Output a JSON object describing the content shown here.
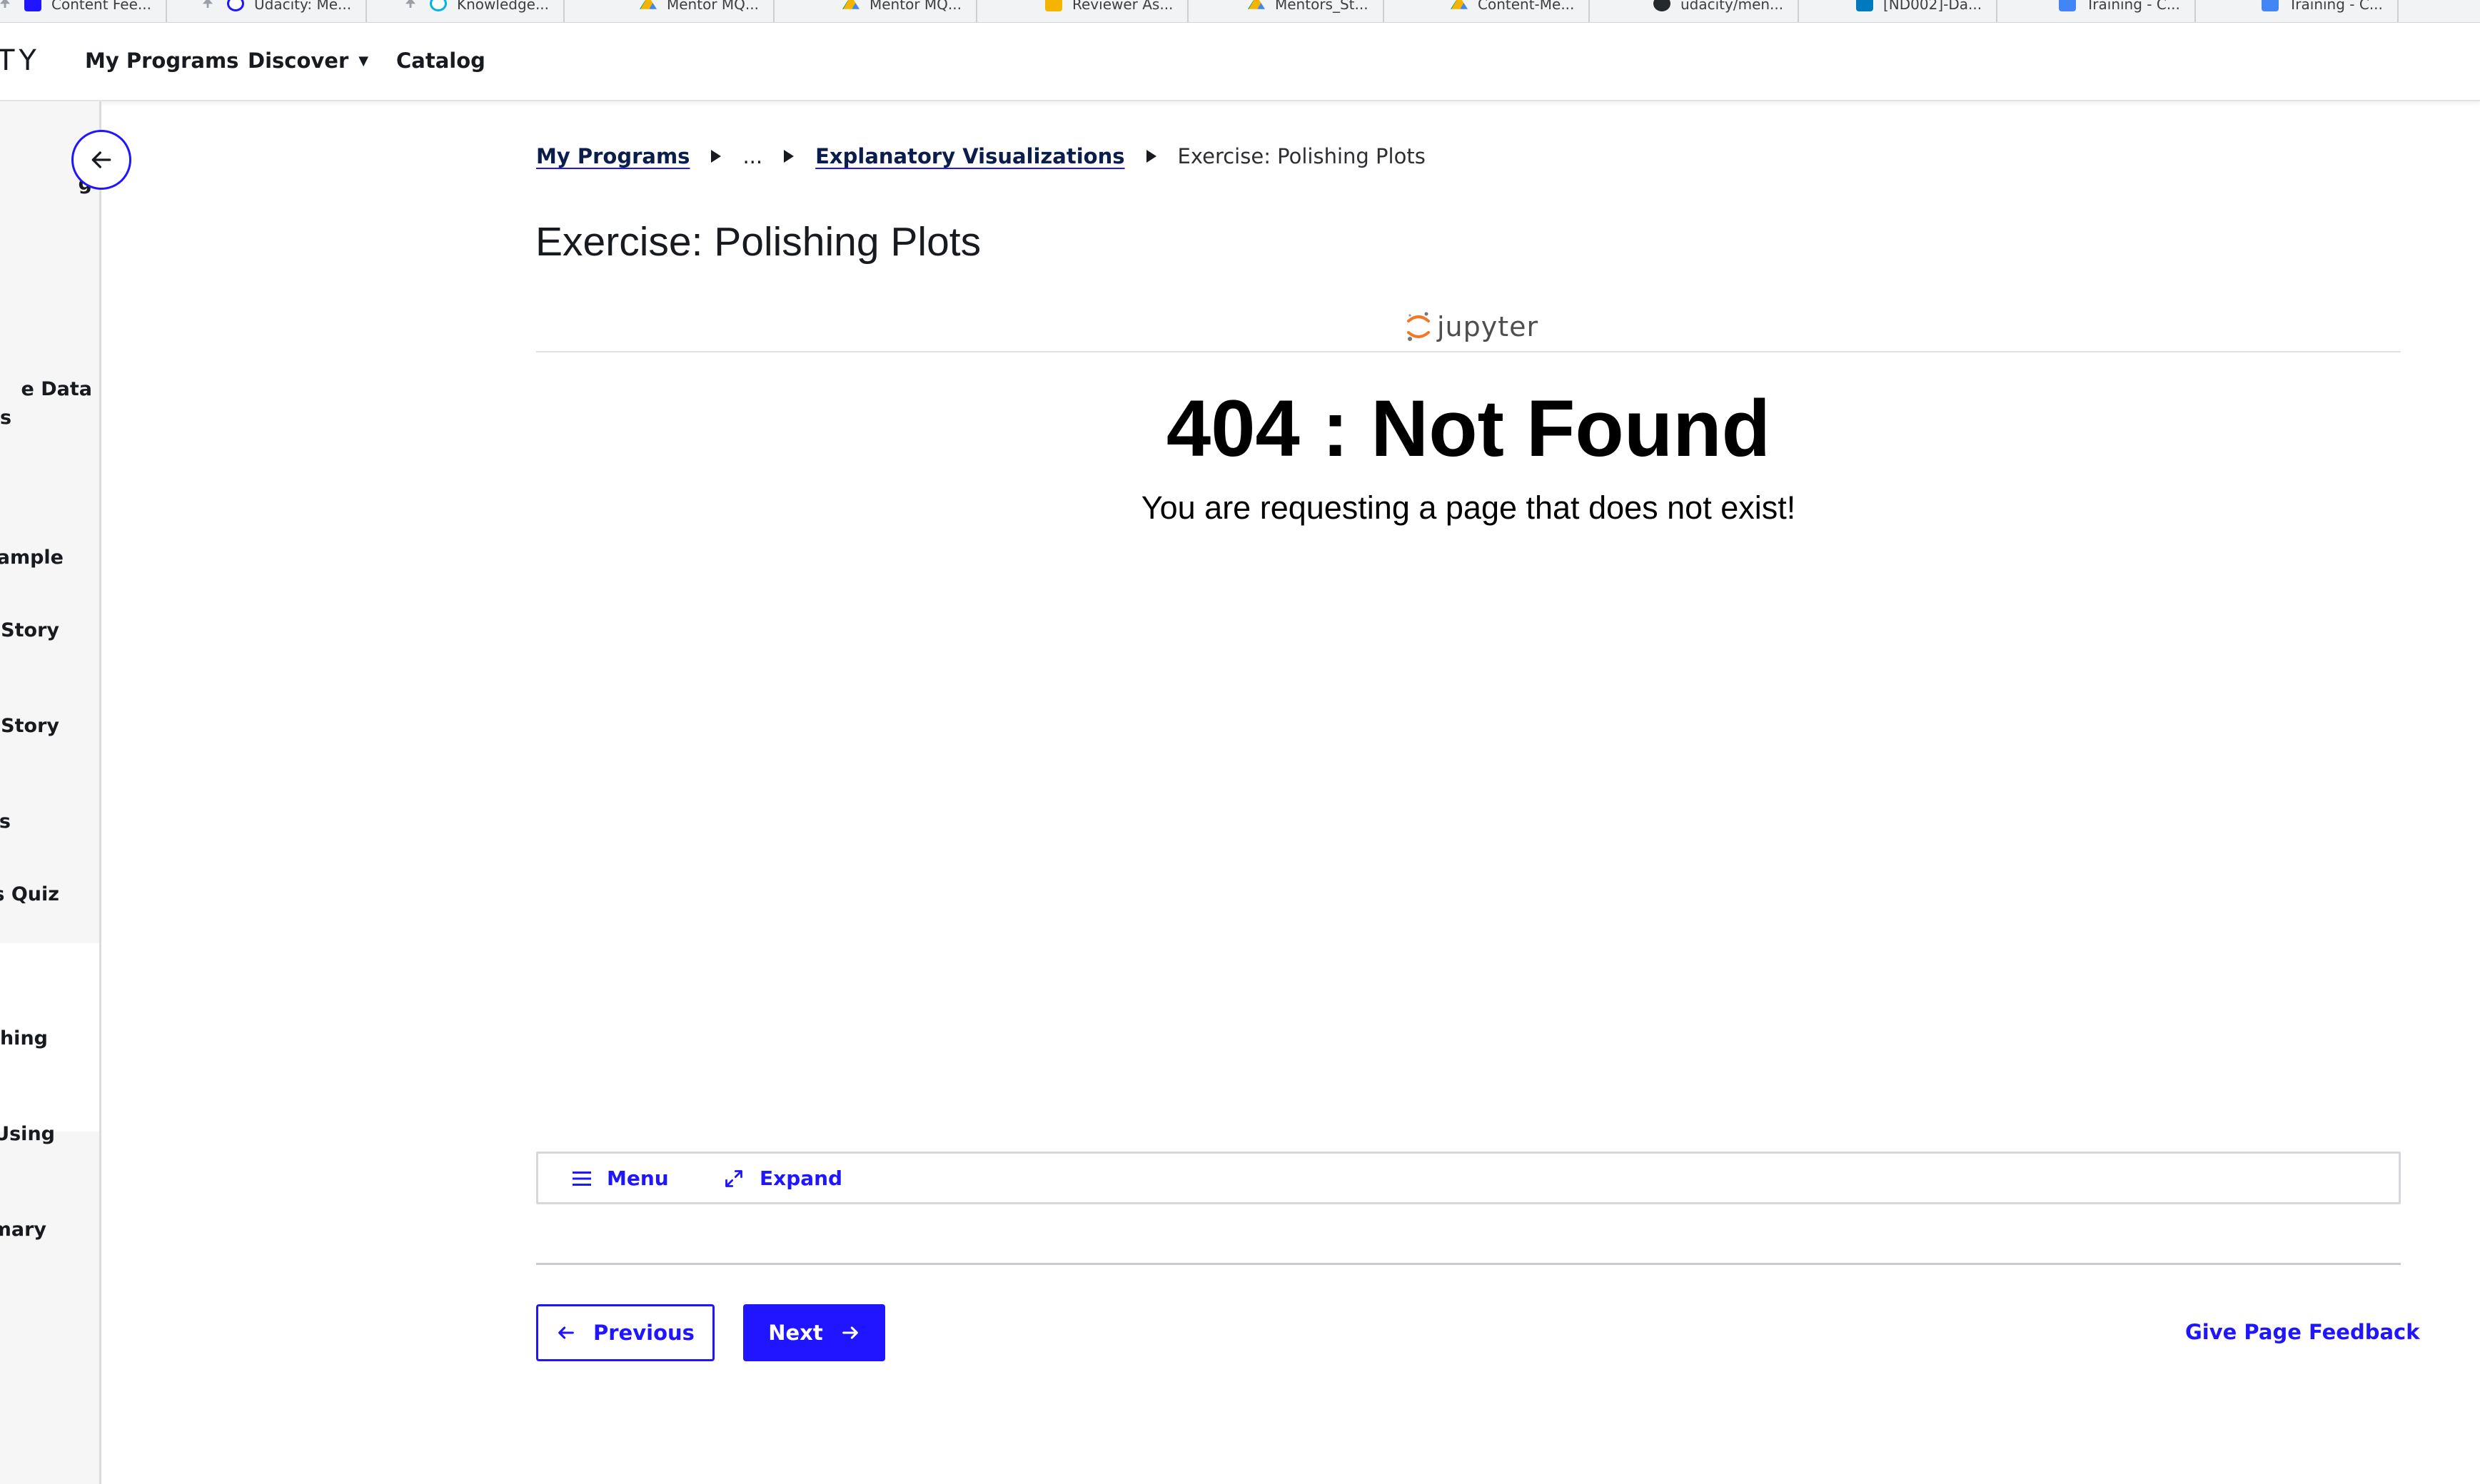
{
  "bookmarks": [
    {
      "label": "Content Fee...",
      "icon": "content-feedback-icon"
    },
    {
      "label": "Udacity: Me...",
      "icon": "udacity-icon"
    },
    {
      "label": "Knowledge...",
      "icon": "knowledge-icon"
    },
    {
      "label": "Mentor MQ...",
      "icon": "google-drive-icon"
    },
    {
      "label": "Mentor MQ...",
      "icon": "google-drive-icon"
    },
    {
      "label": "Reviewer As...",
      "icon": "google-slides-icon"
    },
    {
      "label": "Mentors_St...",
      "icon": "google-drive-icon"
    },
    {
      "label": "Content-Me...",
      "icon": "google-drive-icon"
    },
    {
      "label": "udacity/men...",
      "icon": "github-icon"
    },
    {
      "label": "[ND002]-Da...",
      "icon": "trello-icon"
    },
    {
      "label": "Training - C...",
      "icon": "google-docs-icon"
    },
    {
      "label": "Training - C...",
      "icon": "google-docs-icon"
    }
  ],
  "nav": {
    "logo_fragment": "TY",
    "my_programs": "My Programs",
    "discover": "Discover",
    "catalog": "Catalog"
  },
  "sidebar": {
    "items": [
      {
        "label": "g"
      },
      {
        "label": "e Data"
      },
      {
        "label": "s"
      },
      {
        "label": "xample"
      },
      {
        "label": "a Story"
      },
      {
        "label": "a Story"
      },
      {
        "label": "ts"
      },
      {
        "label": "ts Quiz"
      },
      {
        "label": "shing"
      },
      {
        "label": "Using"
      },
      {
        "label": "mary"
      }
    ]
  },
  "breadcrumb": {
    "root": "My Programs",
    "ellipsis": "...",
    "parent": "Explanatory Visualizations",
    "current": "Exercise: Polishing Plots"
  },
  "page": {
    "title": "Exercise: Polishing Plots"
  },
  "jupyter": {
    "brand": "jupyter",
    "error_title": "404 : Not Found",
    "error_message": "You are requesting a page that does not exist!"
  },
  "toolbar": {
    "menu_label": "Menu",
    "expand_label": "Expand"
  },
  "footer": {
    "previous_label": "Previous",
    "next_label": "Next",
    "feedback_label": "Give Page Feedback"
  },
  "colors": {
    "accent": "#2015ff",
    "sidebar_bg": "#f6f6f7",
    "text": "#171a1f"
  }
}
